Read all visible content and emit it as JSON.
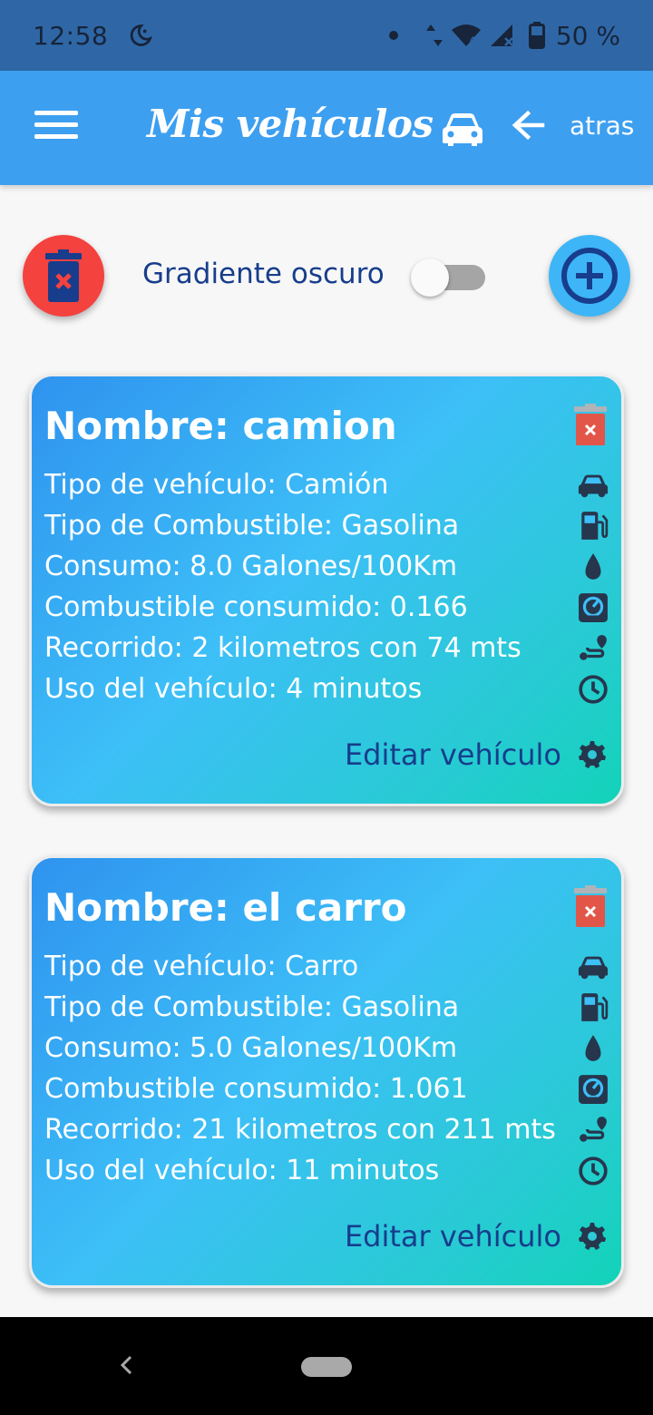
{
  "status_bar": {
    "time": "12:58",
    "battery": "50 %"
  },
  "app_bar": {
    "title": "Mis vehículos",
    "back_label": "atras"
  },
  "controls": {
    "gradient_label": "Gradiente oscuro",
    "gradient_dark_on": false
  },
  "vehicles": [
    {
      "title": "Nombre: camion",
      "rows": {
        "type": "Tipo de vehículo: Camión",
        "fuel_type": "Tipo de Combustible: Gasolina",
        "consumption": "Consumo: 8.0 Galones/100Km",
        "fuel_used": "Combustible consumido: 0.166",
        "distance": "Recorrido: 2 kilometros con 74 mts",
        "usage": "Uso del vehículo: 4 minutos"
      },
      "edit_label": "Editar vehículo"
    },
    {
      "title": "Nombre: el carro",
      "rows": {
        "type": "Tipo de vehículo: Carro",
        "fuel_type": "Tipo de Combustible: Gasolina",
        "consumption": "Consumo: 5.0 Galones/100Km",
        "fuel_used": "Combustible consumido: 1.061",
        "distance": "Recorrido: 21 kilometros con 211 mts",
        "usage": "Uso del vehículo: 11 minutos"
      },
      "edit_label": "Editar vehículo"
    }
  ],
  "icons": {
    "row_icons": [
      "car-icon",
      "gas-pump-icon",
      "drop-icon",
      "gauge-icon",
      "route-icon",
      "clock-icon"
    ],
    "card_delete": "trash-icon",
    "edit": "gear-icon"
  },
  "colors": {
    "app_bar": "#3d9ff0",
    "status_bar": "#2f67a6",
    "delete_button": "#f4423f",
    "add_button": "#3eb5f6",
    "accent_text": "#173d8c",
    "card_icon": "#26364d",
    "card_delete": "#e2564a"
  }
}
